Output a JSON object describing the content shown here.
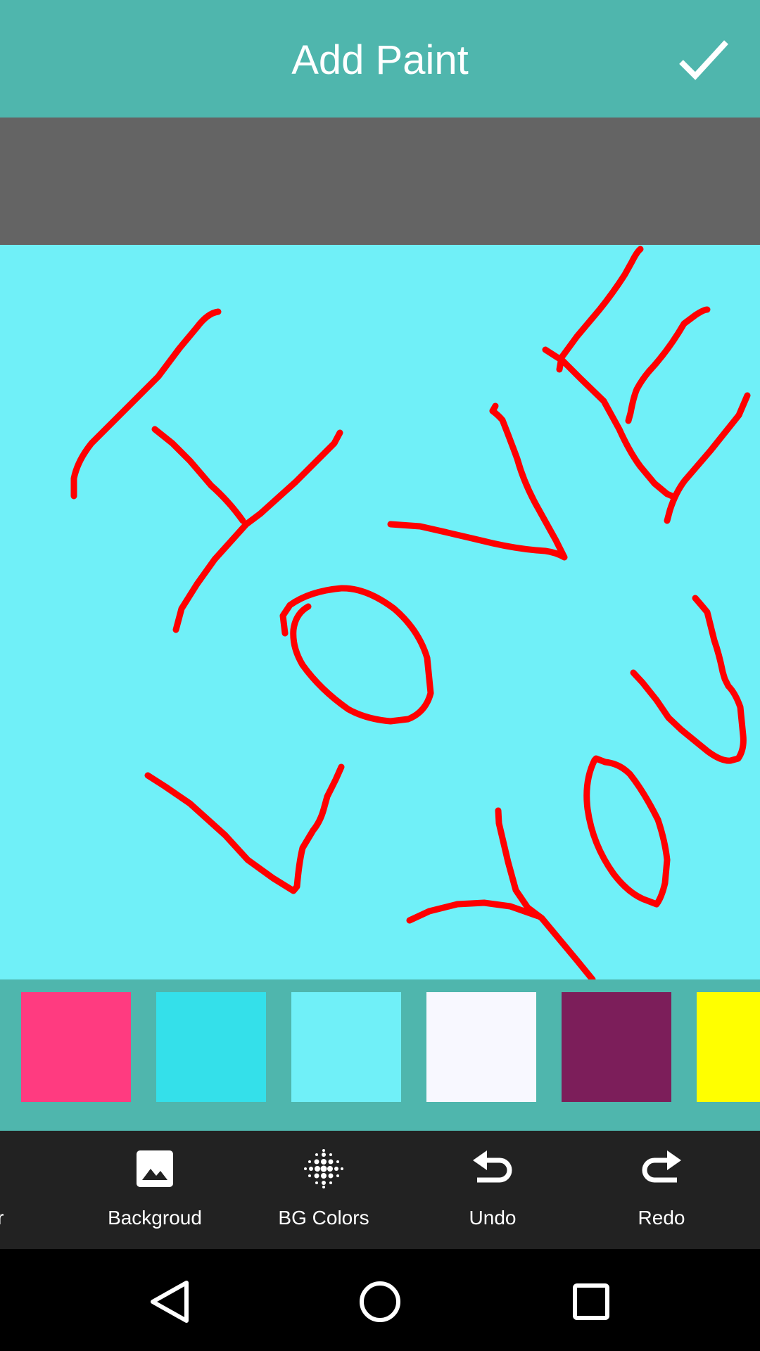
{
  "header": {
    "title": "Add Paint",
    "confirm_icon": "checkmark-icon"
  },
  "canvas": {
    "background_color": "#70f0f8",
    "stroke_color": "#ff0000",
    "drawn_text": "I LOVE YOU"
  },
  "palette": {
    "swatches": [
      "#ff3b80",
      "#34e0ea",
      "#70f0f8",
      "#f8f8ff",
      "#7c1e5a",
      "#ffff00"
    ]
  },
  "toolbar": {
    "items": [
      {
        "label": "Color",
        "icon": "palette-icon"
      },
      {
        "label": "Backgroud",
        "icon": "image-icon"
      },
      {
        "label": "BG Colors",
        "icon": "dots-grid-icon"
      },
      {
        "label": "Undo",
        "icon": "undo-icon"
      },
      {
        "label": "Redo",
        "icon": "redo-icon"
      }
    ]
  },
  "navbar": {
    "back_icon": "back-triangle-icon",
    "home_icon": "home-circle-icon",
    "recents_icon": "recents-square-icon"
  }
}
